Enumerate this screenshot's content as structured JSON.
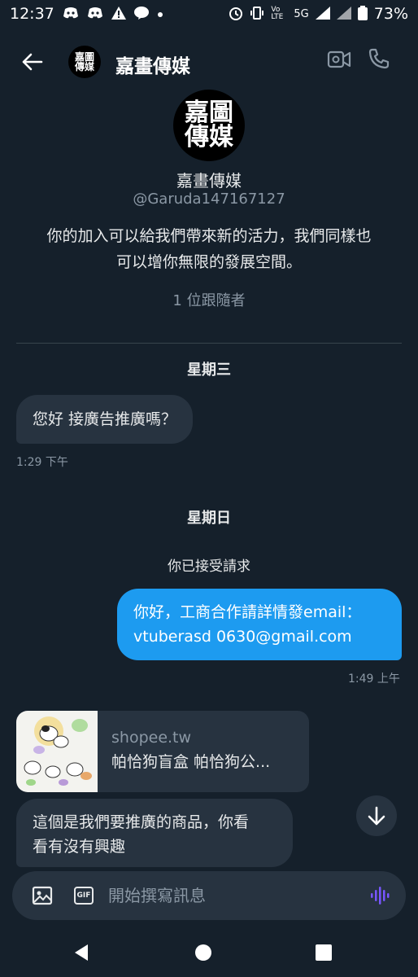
{
  "status_bar": {
    "time": "12:37",
    "net_label_1": "5G",
    "volte": "Vo LTE",
    "battery": "73%"
  },
  "header": {
    "title": "嘉畫傳媒"
  },
  "profile": {
    "logo_text_1": "嘉圖",
    "logo_text_2": "傳媒",
    "name": "嘉畫傳媒",
    "handle": "@Garuda147167127",
    "bio_line1": "你的加入可以給我們帶來新的活力，我們同樣也",
    "bio_line2": "可以增你無限的發展空間。",
    "followers": "1 位跟隨者"
  },
  "conversation": {
    "day1": "星期三",
    "msg1": "您好 接廣告推廣嗎？",
    "msg1_time": "1:29 下午",
    "day2": "星期日",
    "system": "你已接受請求",
    "msg2_line1": "你好，工商合作請詳情發email：",
    "msg2_line2": "vtuberasd 0630@gmail.com",
    "msg2_time": "1:49 上午",
    "link_domain": "shopee.tw",
    "link_title": "帕恰狗盲盒 帕恰狗公...",
    "msg3_line1": "這個是我們要推廣的商品，你看",
    "msg3_line2": "看有沒有興趣"
  },
  "composer": {
    "placeholder": "開始撰寫訊息",
    "gif_label": "GIF"
  },
  "colors": {
    "background": "#15202b",
    "bubble_in": "#273340",
    "bubble_out": "#1d9bf0",
    "voice_accent": "#7856ff"
  }
}
